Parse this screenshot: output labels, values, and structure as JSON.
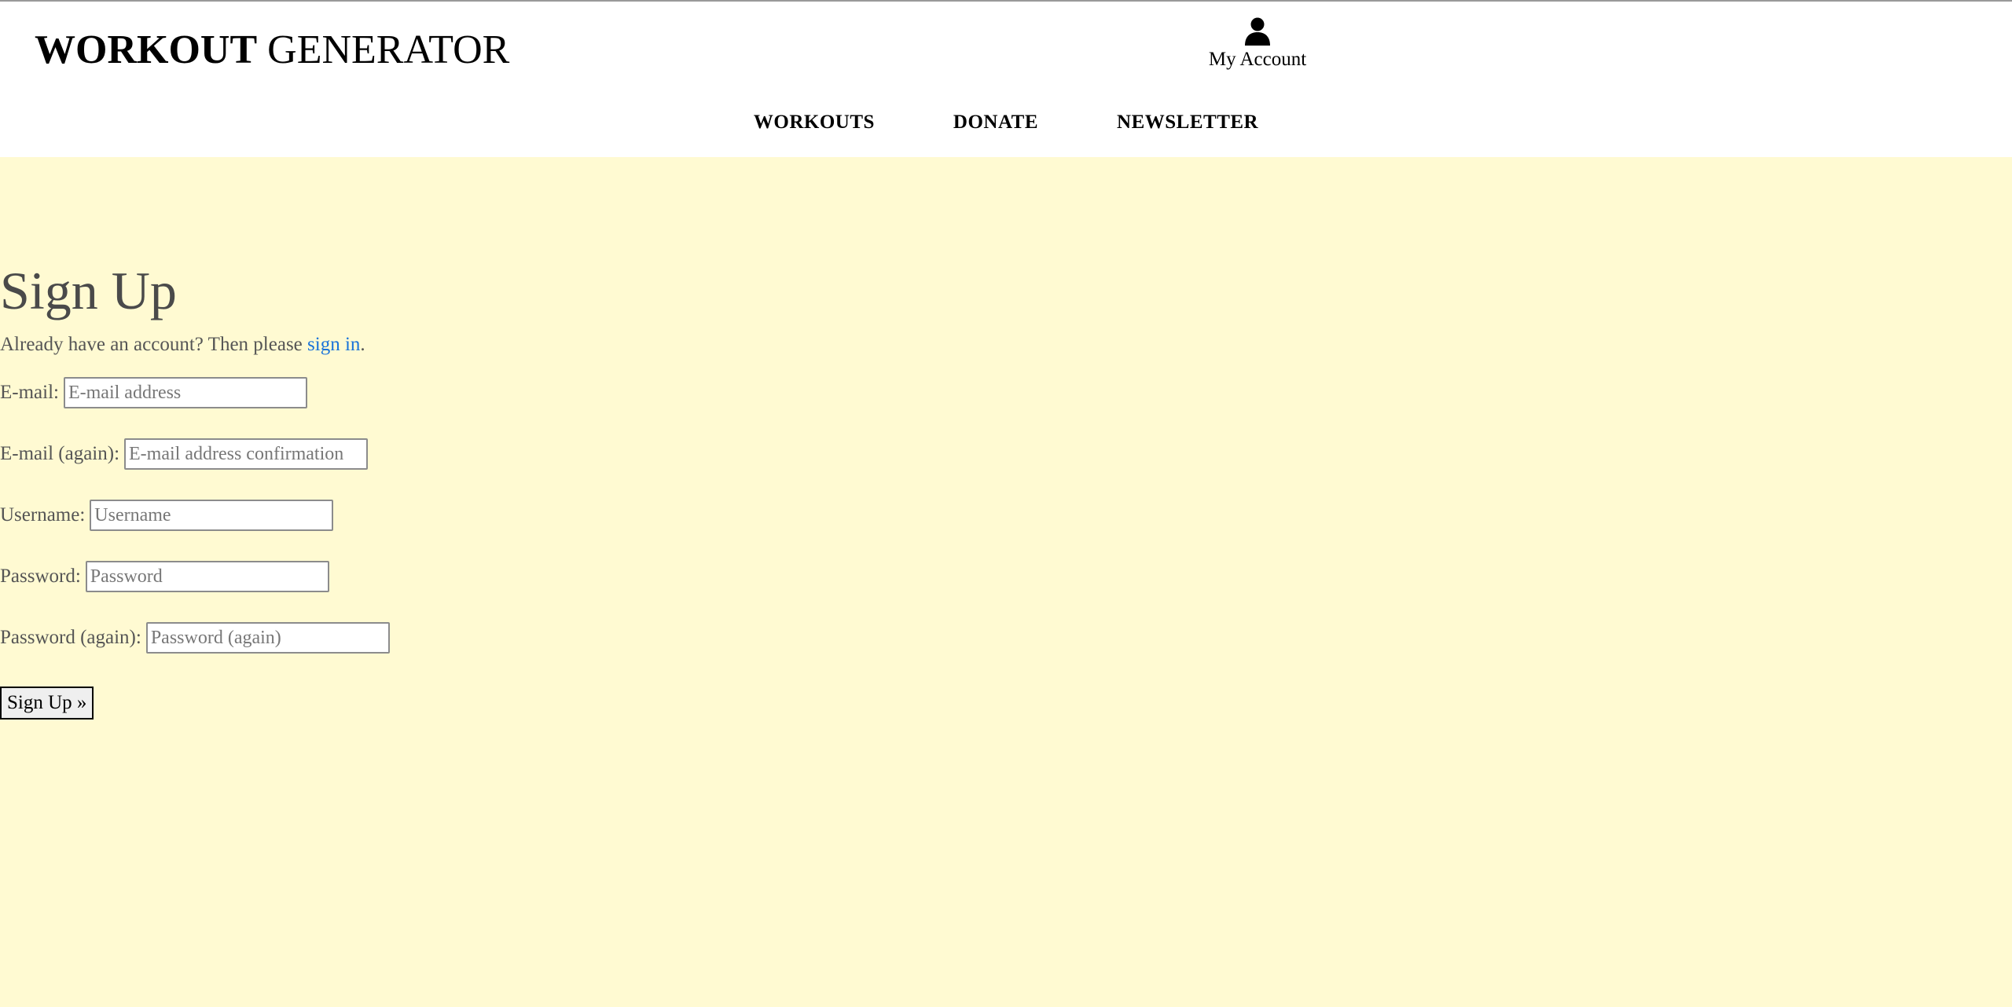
{
  "header": {
    "brand_bold": "WORKOUT",
    "brand_regular": "GENERATOR",
    "account_label": "My Account"
  },
  "nav": {
    "items": [
      {
        "label": "WORKOUTS"
      },
      {
        "label": "DONATE"
      },
      {
        "label": "NEWSLETTER"
      }
    ]
  },
  "form": {
    "title": "Sign Up",
    "signin_prefix": "Already have an account? Then please ",
    "signin_link": "sign in",
    "signin_suffix": ".",
    "fields": [
      {
        "label": "E-mail:",
        "placeholder": "E-mail address",
        "value": ""
      },
      {
        "label": "E-mail (again):",
        "placeholder": "E-mail address confirmation",
        "value": ""
      },
      {
        "label": "Username:",
        "placeholder": "Username",
        "value": ""
      },
      {
        "label": "Password:",
        "placeholder": "Password",
        "value": ""
      },
      {
        "label": "Password (again):",
        "placeholder": "Password (again)",
        "value": ""
      }
    ],
    "submit_label": "Sign Up »"
  },
  "colors": {
    "main_background": "#fffad2",
    "link": "#1a73d9",
    "text": "#555555"
  },
  "icons": {
    "account": "user-icon"
  }
}
